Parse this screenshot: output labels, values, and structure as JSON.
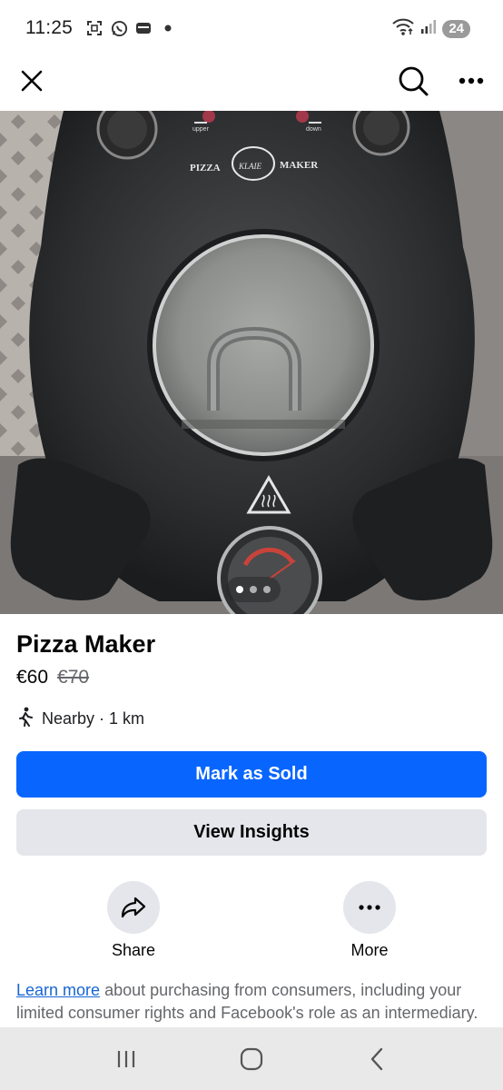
{
  "status_bar": {
    "time": "11:25",
    "battery": "24",
    "icons_left": [
      "screenshot-icon",
      "whatsapp-icon",
      "wallet-icon",
      "dot-icon"
    ],
    "icons_right": [
      "wifi-icon",
      "signal-icon",
      "battery-icon"
    ]
  },
  "nav": {
    "close_icon": "close-icon",
    "search_icon": "search-icon",
    "more_icon": "more-icon"
  },
  "photo": {
    "brand_left": "PIZZA",
    "brand_logo": "KLAIE",
    "brand_right": "MAKER",
    "label_upper": "upper",
    "label_down": "down",
    "pager": {
      "count": 3,
      "active_index": 0
    }
  },
  "listing": {
    "title": "Pizza Maker",
    "price": "€60",
    "old_price": "€70",
    "location": "Nearby · 1 km"
  },
  "buttons": {
    "mark_sold": "Mark as Sold",
    "view_insights": "View Insights"
  },
  "actions": {
    "share": "Share",
    "more": "More"
  },
  "disclaimer": {
    "link_text": "Learn more",
    "text": " about purchasing from consumers, including your limited consumer rights and Facebook's role as an intermediary."
  },
  "colors": {
    "primary": "#0866ff",
    "secondary_bg": "#e4e6eb",
    "link": "#1766d1",
    "muted_text": "#65676b"
  }
}
